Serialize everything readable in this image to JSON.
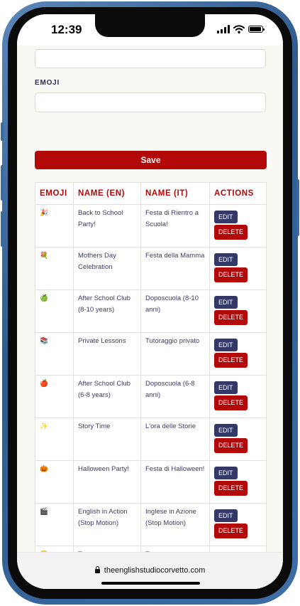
{
  "status_bar": {
    "time": "12:39"
  },
  "form": {
    "emoji_label": "EMOJI",
    "save_label": "Save"
  },
  "table": {
    "headers": [
      "EMOJI",
      "NAME (EN)",
      "NAME (IT)",
      "ACTIONS"
    ],
    "edit_label": "EDIT",
    "delete_label": "DELETE",
    "rows": [
      {
        "emoji": "🎉",
        "name_en": "Back to School Party!",
        "name_it": "Festa di Rientro a Scuola!"
      },
      {
        "emoji": "💐",
        "name_en": "Mothers Day Celebration",
        "name_it": "Festa della Mamma"
      },
      {
        "emoji": "🍏",
        "name_en": "After School Club (8-10 years)",
        "name_it": "Doposcuola (8-10 anni)"
      },
      {
        "emoji": "📚",
        "name_en": "Private Lessons",
        "name_it": "Tutoraggio privato"
      },
      {
        "emoji": "🍎",
        "name_en": "After School Club (6-8 years)",
        "name_it": "Doposcuola (6-8 anni)"
      },
      {
        "emoji": "✨",
        "name_en": "Story Time",
        "name_it": "L'ora delle Storie"
      },
      {
        "emoji": "🎃",
        "name_en": "Halloween Party!",
        "name_it": "Festa di Halloween!"
      },
      {
        "emoji": "🎬",
        "name_en": "English in Action (Stop Motion)",
        "name_it": "Inglese in Azione (Stop Motion)"
      },
      {
        "emoji": "😊",
        "name_en": "Test event",
        "name_it": "Test event"
      }
    ]
  },
  "browser": {
    "url": "theenglishstudiocorvetto.com"
  },
  "colors": {
    "accent_red": "#b30808",
    "navy": "#343866",
    "frame_blue": "#3d6ea6"
  }
}
